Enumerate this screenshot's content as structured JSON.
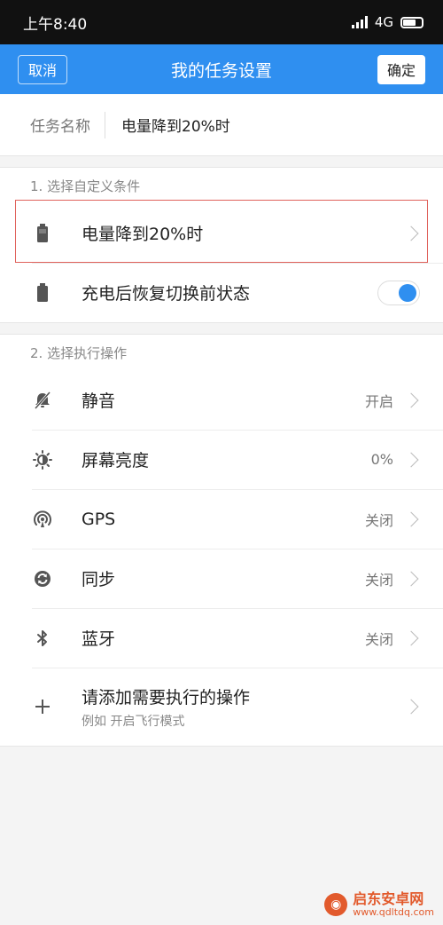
{
  "status_bar": {
    "time": "上午8:40",
    "network": "4G"
  },
  "nav": {
    "cancel_label": "取消",
    "title": "我的任务设置",
    "ok_label": "确定"
  },
  "task_name": {
    "label": "任务名称",
    "value": "电量降到20%时"
  },
  "conditions": {
    "header": "1. 选择自定义条件",
    "items": [
      {
        "label": "电量降到20%时",
        "icon": "battery-icon"
      },
      {
        "label": "充电后恢复切换前状态",
        "icon": "battery-icon",
        "toggle_on": true
      }
    ]
  },
  "actions": {
    "header": "2. 选择执行操作",
    "items": [
      {
        "label": "静音",
        "value": "开启",
        "icon": "mute-bell-icon"
      },
      {
        "label": "屏幕亮度",
        "value": "0%",
        "icon": "brightness-icon"
      },
      {
        "label": "GPS",
        "value": "关闭",
        "icon": "gps-icon"
      },
      {
        "label": "同步",
        "value": "关闭",
        "icon": "sync-icon"
      },
      {
        "label": "蓝牙",
        "value": "关闭",
        "icon": "bluetooth-icon"
      }
    ],
    "add": {
      "label": "请添加需要执行的操作",
      "sub": "例如 开启飞行模式",
      "icon": "plus-icon"
    }
  },
  "watermark": {
    "main": "启东安卓网",
    "url": "www.qdltdq.com"
  },
  "colors": {
    "accent": "#2f8ff0",
    "highlight": "#e0625c"
  }
}
